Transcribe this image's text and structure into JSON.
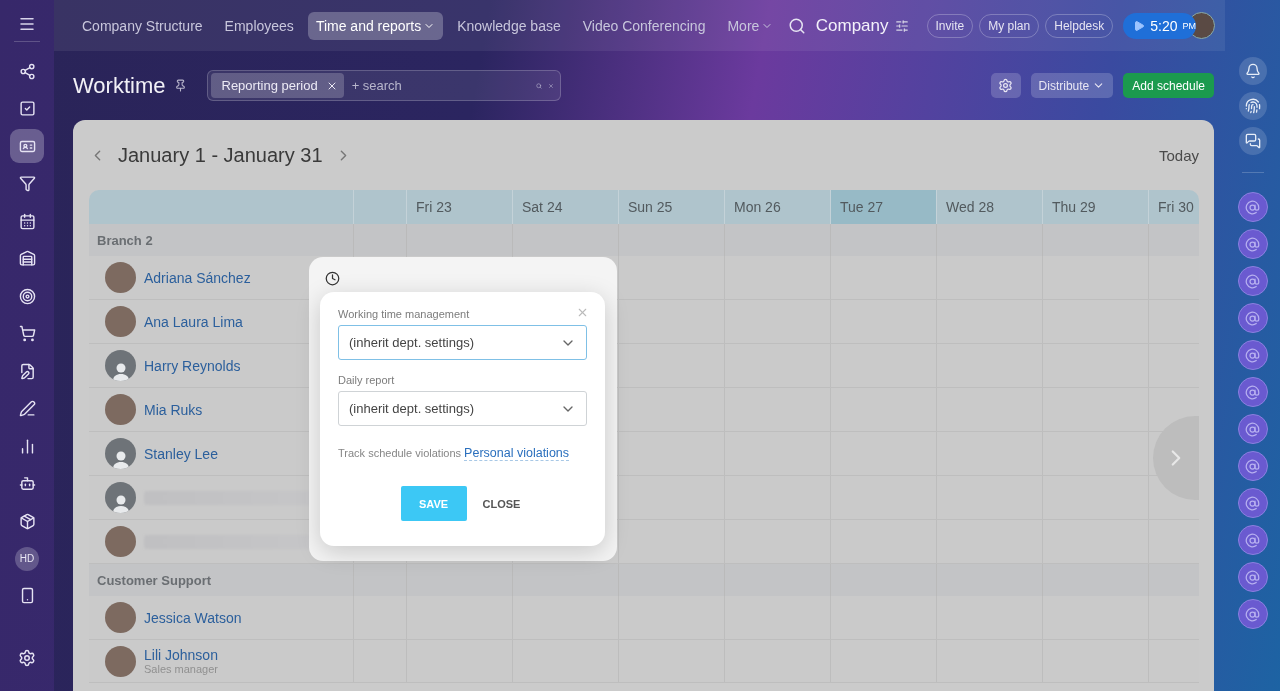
{
  "left_sidebar": {
    "items": [
      {
        "kind": "icon",
        "selected": false
      },
      {
        "kind": "icon",
        "selected": false
      },
      {
        "kind": "icon",
        "selected": true
      },
      {
        "kind": "icon",
        "selected": false
      },
      {
        "kind": "icon",
        "selected": false
      },
      {
        "kind": "icon",
        "selected": false
      },
      {
        "kind": "icon",
        "selected": false
      },
      {
        "kind": "icon",
        "selected": false
      },
      {
        "kind": "icon",
        "selected": false
      },
      {
        "kind": "icon",
        "selected": false
      },
      {
        "kind": "icon",
        "selected": false
      },
      {
        "kind": "icon",
        "selected": false
      },
      {
        "kind": "icon",
        "selected": false
      },
      {
        "kind": "text",
        "label": "HD",
        "selected": false
      },
      {
        "kind": "icon",
        "selected": false
      }
    ]
  },
  "top_nav": {
    "tabs": [
      {
        "label": "Company Structure",
        "selected": false,
        "dropdown": false
      },
      {
        "label": "Employees",
        "selected": false,
        "dropdown": false
      },
      {
        "label": "Time and reports",
        "selected": true,
        "dropdown": true
      },
      {
        "label": "Knowledge base",
        "selected": false,
        "dropdown": false
      },
      {
        "label": "Video Conferencing",
        "selected": false,
        "dropdown": false
      },
      {
        "label": "More",
        "selected": false,
        "dropdown": true
      }
    ],
    "company": "Company",
    "buttons": [
      "Invite",
      "My plan",
      "Helpdesk"
    ],
    "timer": {
      "time": "5:20",
      "suffix": "PM"
    }
  },
  "header": {
    "title": "Worktime",
    "filter": {
      "chip": "Reporting period",
      "placeholder": "+ search"
    },
    "distribute": "Distribute",
    "add": "Add schedule"
  },
  "calendar": {
    "period": "January 1 - January 31",
    "today": "Today",
    "days": [
      {
        "label": "Fri 23",
        "today": false
      },
      {
        "label": "Sat 24",
        "today": false
      },
      {
        "label": "Sun 25",
        "today": false
      },
      {
        "label": "Mon 26",
        "today": false
      },
      {
        "label": "Tue 27",
        "today": true
      },
      {
        "label": "Wed 28",
        "today": false
      },
      {
        "label": "Thu 29",
        "today": false
      },
      {
        "label": "Fri 30",
        "today": false
      }
    ],
    "groups": [
      {
        "name": "Branch 2",
        "employees": [
          {
            "name": "Adriana Sánchez",
            "avatar": {
              "kind": "photo"
            }
          },
          {
            "name": "Ana Laura Lima",
            "avatar": {
              "kind": "photo"
            }
          },
          {
            "name": "Harry Reynolds",
            "avatar": {
              "kind": "silhouette"
            }
          },
          {
            "name": "Mia Ruks",
            "avatar": {
              "kind": "photo"
            }
          },
          {
            "name": "Stanley Lee",
            "avatar": {
              "kind": "silhouette"
            }
          },
          {
            "name_hidden": true,
            "avatar": {
              "kind": "silhouette"
            }
          },
          {
            "name_hidden": true,
            "avatar": {
              "kind": "photo"
            }
          }
        ]
      },
      {
        "name": "Customer Support",
        "employees": [
          {
            "name": "Jessica Watson",
            "avatar": {
              "kind": "photo"
            }
          },
          {
            "name": "Lili Johnson",
            "subtitle": "Sales manager",
            "avatar": {
              "kind": "photo"
            }
          }
        ]
      }
    ]
  },
  "dialog": {
    "fields": [
      {
        "label": "Working time management",
        "value": "(inherit dept. settings)",
        "focused": true
      },
      {
        "label": "Daily report",
        "value": "(inherit dept. settings)",
        "focused": false
      }
    ],
    "violations": {
      "text": "Track schedule violations",
      "link": "Personal violations"
    },
    "save": "SAVE",
    "close": "CLOSE"
  }
}
